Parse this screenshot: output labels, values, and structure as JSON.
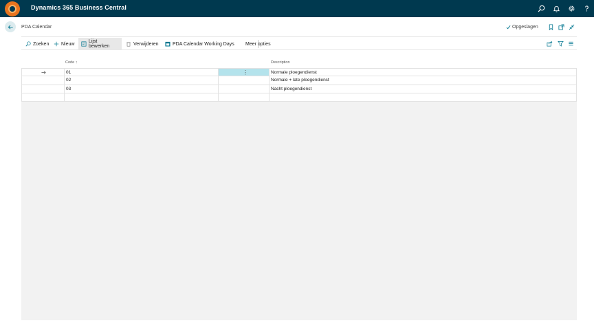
{
  "app": {
    "title": "Dynamics 365 Business Central"
  },
  "topbar_icons": [
    "search-icon",
    "bell-icon",
    "gear-icon",
    "help-icon"
  ],
  "page": {
    "title": "PDA Calendar",
    "saved_status": "Opgeslagen"
  },
  "actions": {
    "search": "Zoeken",
    "new": "Nieuw",
    "edit_list": "Lijst bewerken",
    "delete": "Verwijderen",
    "working_days": "PDA Calendar Working Days",
    "more": "Meer opties"
  },
  "table": {
    "columns": {
      "code": "Code",
      "description": "Description"
    },
    "sort_indicator": "↑",
    "rows": [
      {
        "code": "01",
        "description": "Normale ploegendienst"
      },
      {
        "code": "02",
        "description": "Normale + late ploegendienst"
      },
      {
        "code": "03",
        "description": "Nacht ploegendienst"
      },
      {
        "code": "",
        "description": ""
      }
    ]
  },
  "colors": {
    "appbar": "#00394f",
    "accent": "#00758f",
    "selected_cell": "#b4e3ec",
    "logo": "#e8741e"
  }
}
